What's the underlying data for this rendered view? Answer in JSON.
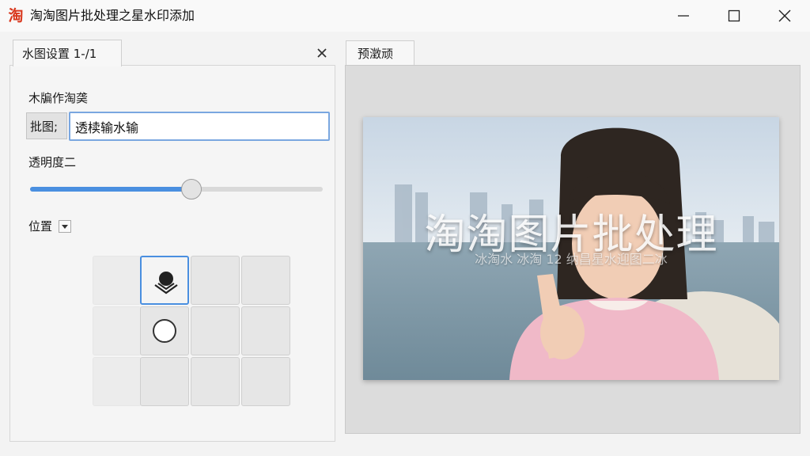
{
  "window": {
    "app_icon_text": "淘",
    "title": "淘淘图片批处理之星水印添加"
  },
  "left_panel": {
    "tab_label": "水图设置  1-/1",
    "content_label": "木牑作淘䶮",
    "prefix_button": "批图;",
    "text_value": "透椟输水输",
    "opacity_label": "透明度⼆",
    "opacity_fraction": 0.55,
    "position_label": "位置",
    "selected_position": "top-center"
  },
  "preview": {
    "tab_label": "预澂顽",
    "watermark_main": "淘淘图片批处理",
    "watermark_sub": "冰淘水 冰淘 12 纳昌星水迎图⼆冰"
  },
  "colors": {
    "accent": "#4a8fe0",
    "app_icon": "#d9381e"
  }
}
